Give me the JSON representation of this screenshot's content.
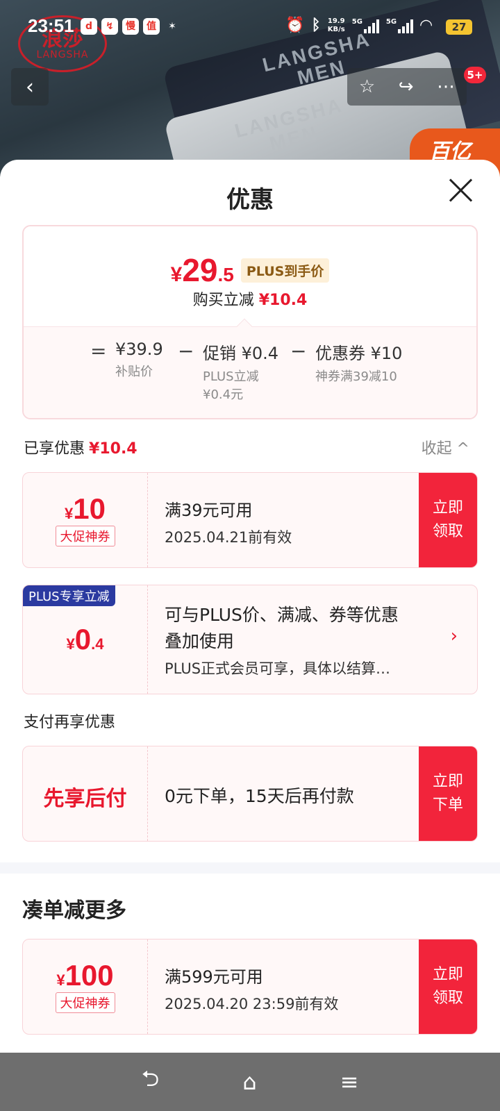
{
  "status_bar": {
    "time": "23:51",
    "app_icons": [
      "douyin-icon",
      "fire-icon",
      "manman-icon",
      "zhi-icon",
      "handshake-icon"
    ],
    "app_icon_glyphs": [
      "d",
      "↯",
      "慢",
      "值",
      "✶"
    ],
    "net_speed_value": "19.9",
    "net_speed_unit": "KB/s",
    "sim1": "5G",
    "sim2": "5G",
    "battery": "27"
  },
  "product_header": {
    "brand_cn": "浪莎",
    "brand_en": "LANGSHA",
    "strap_text_1_line1": "LANGSHA",
    "strap_text_1_line2": "MEN",
    "strap_text_2_line1": "LANGSHA",
    "strap_text_2_line2": "MEN",
    "corner_tag": "百亿",
    "badge": "5+"
  },
  "sheet": {
    "title": "优惠",
    "summary": {
      "price_symbol": "¥",
      "price_integer": "29",
      "price_decimal": ".5",
      "price_tag": "PLUS到手价",
      "reduce_label": "购买立减",
      "reduce_amount": "¥10.4",
      "calc": {
        "equals": "=",
        "base_value": "¥39.9",
        "base_label": "补贴价",
        "minus1": "−",
        "promo_value": "促销 ¥0.4",
        "promo_label_1": "PLUS立减",
        "promo_label_2": "¥0.4元",
        "minus2": "−",
        "coupon_value": "优惠券 ¥10",
        "coupon_label": "神券满39减10"
      }
    },
    "enjoyed": {
      "label": "已享优惠",
      "amount": "¥10.4",
      "collapse_label": "收起 ^"
    },
    "coupon1": {
      "symbol": "¥",
      "amount": "10",
      "tag": "大促神券",
      "condition": "满39元可用",
      "validity": "2025.04.21前有效",
      "cta_line1": "立即",
      "cta_line2": "领取"
    },
    "plus_coupon": {
      "label": "PLUS专享立减",
      "symbol": "¥",
      "amount_int": "0",
      "amount_dec": ".4",
      "line1": "可与PLUS价、满减、券等优惠",
      "line2": "叠加使用",
      "line3": "PLUS正式会员可享，具体以结算…",
      "chevron": "›"
    },
    "pay_section": {
      "label": "支付再享优惠",
      "title": "先享后付",
      "description": "0元下单，15天后再付款",
      "cta_line1": "立即",
      "cta_line2": "下单"
    },
    "more": {
      "title": "凑单减更多",
      "coupon": {
        "symbol": "¥",
        "amount": "100",
        "tag": "大促神券",
        "condition": "满599元可用",
        "validity": "2025.04.20 23:59前有效",
        "cta_line1": "立即",
        "cta_line2": "领取"
      }
    }
  },
  "navbar": {
    "back": "⮌",
    "home": "⌂",
    "menu": "≡"
  },
  "colors": {
    "accent_red": "#e8182e",
    "cta_red": "#f2243b",
    "plus_blue": "#2b3aa0"
  }
}
